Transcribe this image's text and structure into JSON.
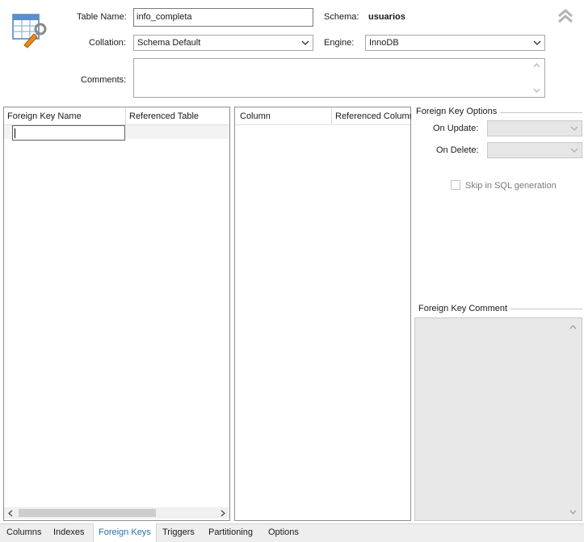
{
  "header": {
    "table_name_label": "Table Name:",
    "table_name_value": "info_completa",
    "schema_label": "Schema:",
    "schema_value": "usuarios",
    "collation_label": "Collation:",
    "collation_value": "Schema Default",
    "engine_label": "Engine:",
    "engine_value": "InnoDB",
    "comments_label": "Comments:",
    "comments_value": "",
    "icons": {
      "table_icon": "table-edit-icon",
      "collapse_icon": "double-chevron-up-icon"
    }
  },
  "fk_table": {
    "columns": [
      "Foreign Key Name",
      "Referenced Table"
    ],
    "editing_value": ""
  },
  "column_table": {
    "columns": [
      "Column",
      "Referenced Column"
    ]
  },
  "fk_options": {
    "title": "Foreign Key Options",
    "on_update_label": "On Update:",
    "on_update_value": "",
    "on_delete_label": "On Delete:",
    "on_delete_value": "",
    "skip_sql_label": "Skip in SQL generation",
    "skip_sql_checked": false
  },
  "fk_comment": {
    "title": "Foreign Key Comment",
    "value": ""
  },
  "tabs": [
    {
      "label": "Columns",
      "active": false
    },
    {
      "label": "Indexes",
      "active": false
    },
    {
      "label": "Foreign Keys",
      "active": true
    },
    {
      "label": "Triggers",
      "active": false
    },
    {
      "label": "Partitioning",
      "active": false
    },
    {
      "label": "Options",
      "active": false
    }
  ],
  "colors": {
    "active_tab": "#2a6fb0",
    "tab_bar": "#eeeeee",
    "disabled": "#e6e6e6"
  }
}
